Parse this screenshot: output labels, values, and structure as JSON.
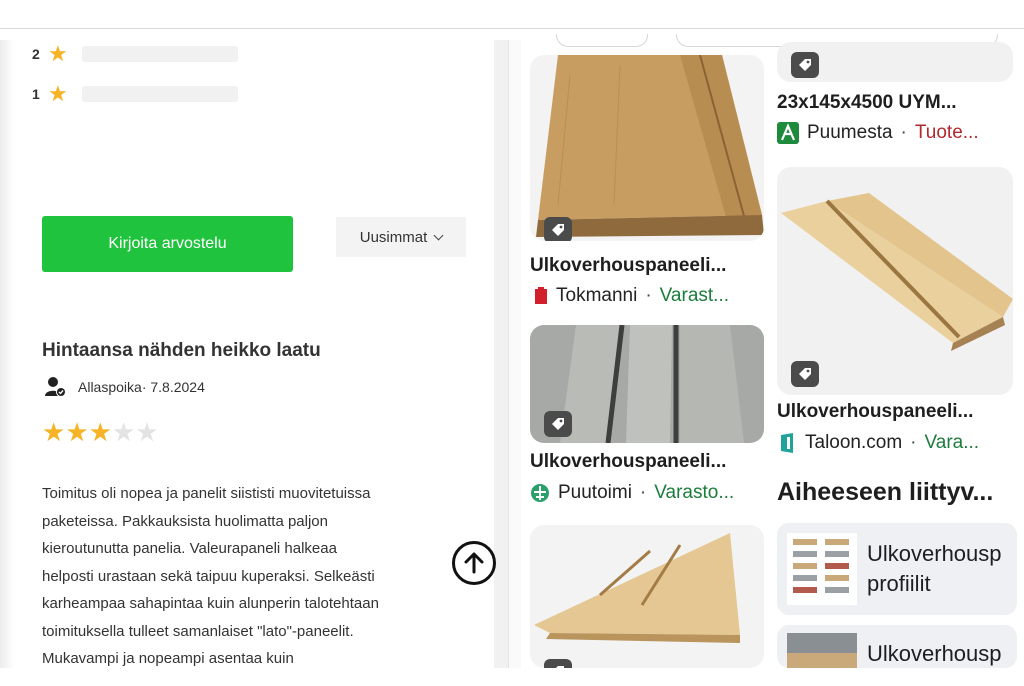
{
  "ratings": [
    {
      "stars": "2"
    },
    {
      "stars": "1"
    }
  ],
  "actions": {
    "write_review": "Kirjoita arvostelu",
    "sort": "Uusimmat"
  },
  "review": {
    "title": "Hintaansa nähden heikko laatu",
    "author_date": "Allaspoika· 7.8.2024",
    "rating": 3,
    "max_rating": 5,
    "body_lines": [
      "Toimitus oli nopea ja panelit siististi muovitetuissa",
      "paketeissa. Pakkauksista huolimatta paljon",
      "kieroutunutta panelia. Valeurapaneli halkeaa",
      "helposti urastaan sekä taipuu kuperaksi. Selkeästi",
      "karheampaa sahapintaa kuin alunperin talotehtaan",
      "toimituksella tulleet samanlaiset \"lato\"-paneelit.",
      "Mukavampi ja nopeampi asentaa kuin"
    ]
  },
  "products": [
    {
      "title": "Ulkoverhouspaneeli...",
      "store": "Tokmanni",
      "sep": "·",
      "status": "Varast..."
    },
    {
      "title": "Ulkoverhouspaneeli...",
      "store": "Puutoimi",
      "sep": "·",
      "status": "Varasto..."
    },
    {
      "title": "23x145x4500 UYM...",
      "store": "Puumesta",
      "sep": "·",
      "status": "Tuote..."
    },
    {
      "title": "Ulkoverhouspaneeli...",
      "store": "Taloon.com",
      "sep": "·",
      "status": "Vara..."
    }
  ],
  "related": {
    "heading": "Aiheeseen liittyv...",
    "items": [
      {
        "line1": "Ulkoverhousp",
        "line2": "profiilit"
      },
      {
        "line1": "Ulkoverhousp",
        "line2": ""
      }
    ]
  },
  "colors": {
    "accent_green": "#20c33d",
    "star_gold": "#f5b325",
    "in_stock_green": "#1c7c3c",
    "out_red": "#b3282d"
  },
  "icons": {
    "rating_star": "star-icon",
    "user": "user-verified-icon",
    "scroll_top": "arrow-up-icon",
    "tag": "price-tag-icon"
  }
}
